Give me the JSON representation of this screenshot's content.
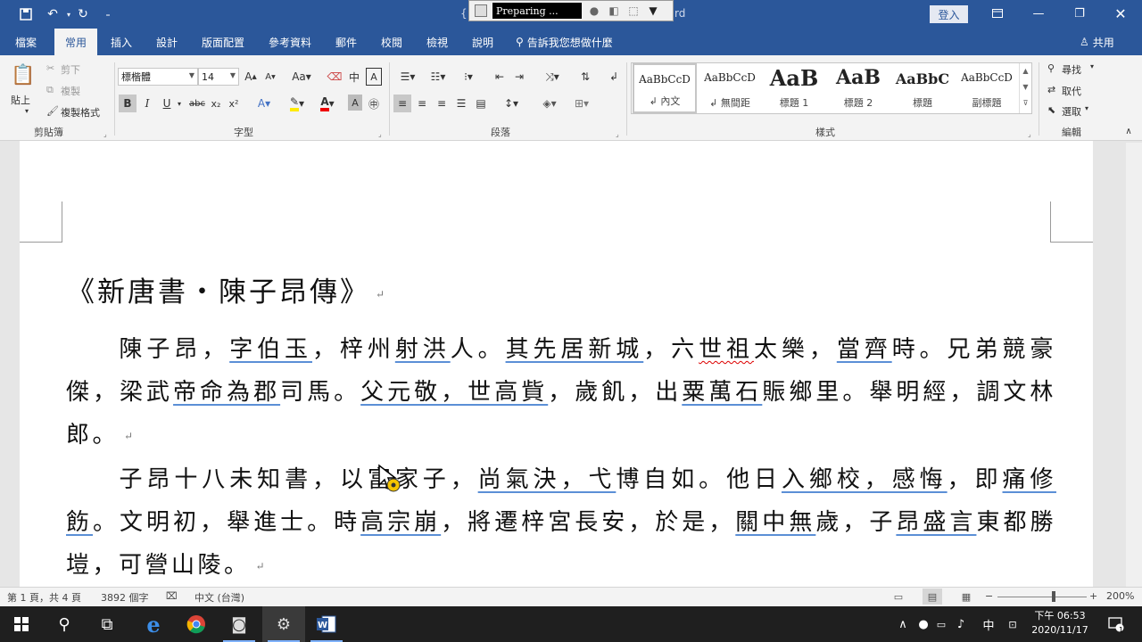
{
  "titlebar": {
    "title_fragment_left": "{",
    "title_fragment_right": "rd",
    "login_label": "登入",
    "recorder": {
      "status": "Preparing ..."
    }
  },
  "tabs": [
    "檔案",
    "常用",
    "插入",
    "設計",
    "版面配置",
    "參考資料",
    "郵件",
    "校閱",
    "檢視",
    "說明"
  ],
  "active_tab": "常用",
  "tell_me": "告訴我您想做什麼",
  "share": "共用",
  "clipboard": {
    "paste": "貼上",
    "cut": "剪下",
    "copy": "複製",
    "format_painter": "複製格式",
    "label": "剪貼簿"
  },
  "font": {
    "name": "標楷體",
    "size": "14",
    "label": "字型"
  },
  "paragraph": {
    "label": "段落"
  },
  "styles": {
    "label": "樣式",
    "items": [
      {
        "preview": "AaBbCcD",
        "name": "內文"
      },
      {
        "preview": "AaBbCcD",
        "name": "無間距"
      },
      {
        "preview": "AaB",
        "name": "標題 1"
      },
      {
        "preview": "AaB",
        "name": "標題 2"
      },
      {
        "preview": "AaBbC",
        "name": "標題"
      },
      {
        "preview": "AaBbCcD",
        "name": "副標題"
      }
    ]
  },
  "editing": {
    "find": "尋找",
    "replace": "取代",
    "select": "選取",
    "label": "編輯"
  },
  "document": {
    "title": "《新唐書・陳子昂傳》",
    "p1": [
      "陳子昂，",
      "字伯玉",
      "，梓州",
      "射洪",
      "人。",
      "其先居新城",
      "，六",
      "世祖",
      "太樂，",
      "當齊",
      "時。兄弟競豪傑，梁武",
      "帝命為郡",
      "司馬。",
      "父元敬，世高貲",
      "，歲飢，出",
      "粟萬石",
      "賑鄉里。舉明經，調文林郎。"
    ],
    "p2": [
      "子昂十八未知書，以富家子，",
      "尚氣決，弋",
      "博自如。他日",
      "入鄉校，感悔",
      "，即",
      "痛修飭",
      "。文明初，舉進士。時",
      "高宗崩",
      "，將遷梓宮長安，於是，",
      "關中無",
      "歲，子",
      "昂盛言",
      "東都勝",
      "塏，可營山陵。"
    ]
  },
  "status": {
    "page": "第 1 頁，共 4 頁",
    "words": "3892 個字",
    "language": "中文 (台灣)",
    "zoom": "200%",
    "zoom_level": 200
  },
  "tray": {
    "ime": "中",
    "time": "下午 06:53",
    "date": "2020/11/17",
    "notifications": "1"
  }
}
